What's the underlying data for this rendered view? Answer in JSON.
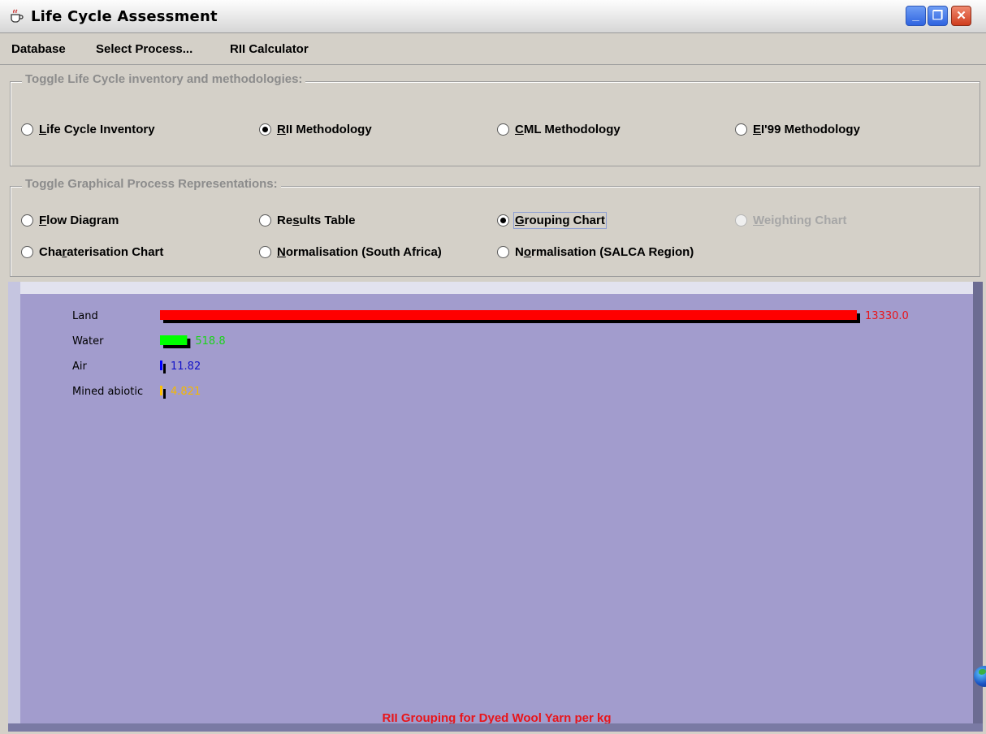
{
  "window": {
    "title": "Life Cycle Assessment",
    "controls": {
      "minimize": "_",
      "restore": "❐",
      "close": "✕"
    }
  },
  "menu": [
    "Database",
    "Select Process...",
    "RII Calculator"
  ],
  "methodologies_panel": {
    "legend": "Toggle Life Cycle inventory and methodologies:",
    "options": [
      {
        "label": "Life Cycle Inventory",
        "mnemonic": "L",
        "rest": "ife Cycle Inventory",
        "selected": false
      },
      {
        "label": "RII Methodology",
        "mnemonic": "R",
        "rest": "II Methodology",
        "selected": true
      },
      {
        "label": "CML Methodology",
        "mnemonic": "C",
        "rest": "ML Methodology",
        "selected": false
      },
      {
        "label": "EI'99 Methodology",
        "mnemonic": "E",
        "rest": "I'99 Methodology",
        "selected": false
      }
    ]
  },
  "representations_panel": {
    "legend": "Toggle Graphical Process Representations:",
    "options": [
      {
        "pre": "",
        "mnemonic": "F",
        "rest": "low Diagram",
        "label": "Flow Diagram",
        "selected": false,
        "enabled": true
      },
      {
        "pre": "Re",
        "mnemonic": "s",
        "rest": "ults Table",
        "label": "Results Table",
        "selected": false,
        "enabled": true
      },
      {
        "pre": "",
        "mnemonic": "G",
        "rest": "rouping Chart",
        "label": "Grouping Chart",
        "selected": true,
        "enabled": true
      },
      {
        "pre": "",
        "mnemonic": "W",
        "rest": "eighting Chart",
        "label": "Weighting Chart",
        "selected": false,
        "enabled": false
      },
      {
        "pre": "Cha",
        "mnemonic": "r",
        "rest": "aterisation Chart",
        "label": "Charaterisation Chart",
        "selected": false,
        "enabled": true
      },
      {
        "pre": "",
        "mnemonic": "N",
        "rest": "ormalisation (South Africa)",
        "label": "Normalisation (South Africa)",
        "selected": false,
        "enabled": true
      },
      {
        "pre": "N",
        "mnemonic": "o",
        "rest": "rmalisation (SALCA Region)",
        "label": "Normalisation (SALCA Region)",
        "selected": false,
        "enabled": true
      }
    ]
  },
  "chart_data": {
    "type": "bar",
    "orientation": "horizontal",
    "title": "RII Grouping for Dyed Wool Yarn per kg",
    "categories": [
      "Land",
      "Water",
      "Air",
      "Mined abiotic"
    ],
    "values": [
      13330.0,
      518.8,
      11.82,
      4.821
    ],
    "value_labels": [
      "13330.0",
      "518.8",
      "11.82",
      "4.821"
    ],
    "colors": [
      "#ff0000",
      "#00ff00",
      "#0000ff",
      "#ffc000"
    ],
    "label_colors": [
      "#e8151a",
      "#1bd41b",
      "#1212c8",
      "#f5b800"
    ],
    "xlim": [
      0,
      13330.0
    ],
    "grid": false,
    "legend": "none"
  },
  "colors": {
    "background": "#d4d0c8",
    "chart_background": "#a29ccd",
    "title_accent": "#e8151a"
  },
  "icons": {
    "app": "coffee-cup-icon",
    "globe": "globe-icon"
  }
}
